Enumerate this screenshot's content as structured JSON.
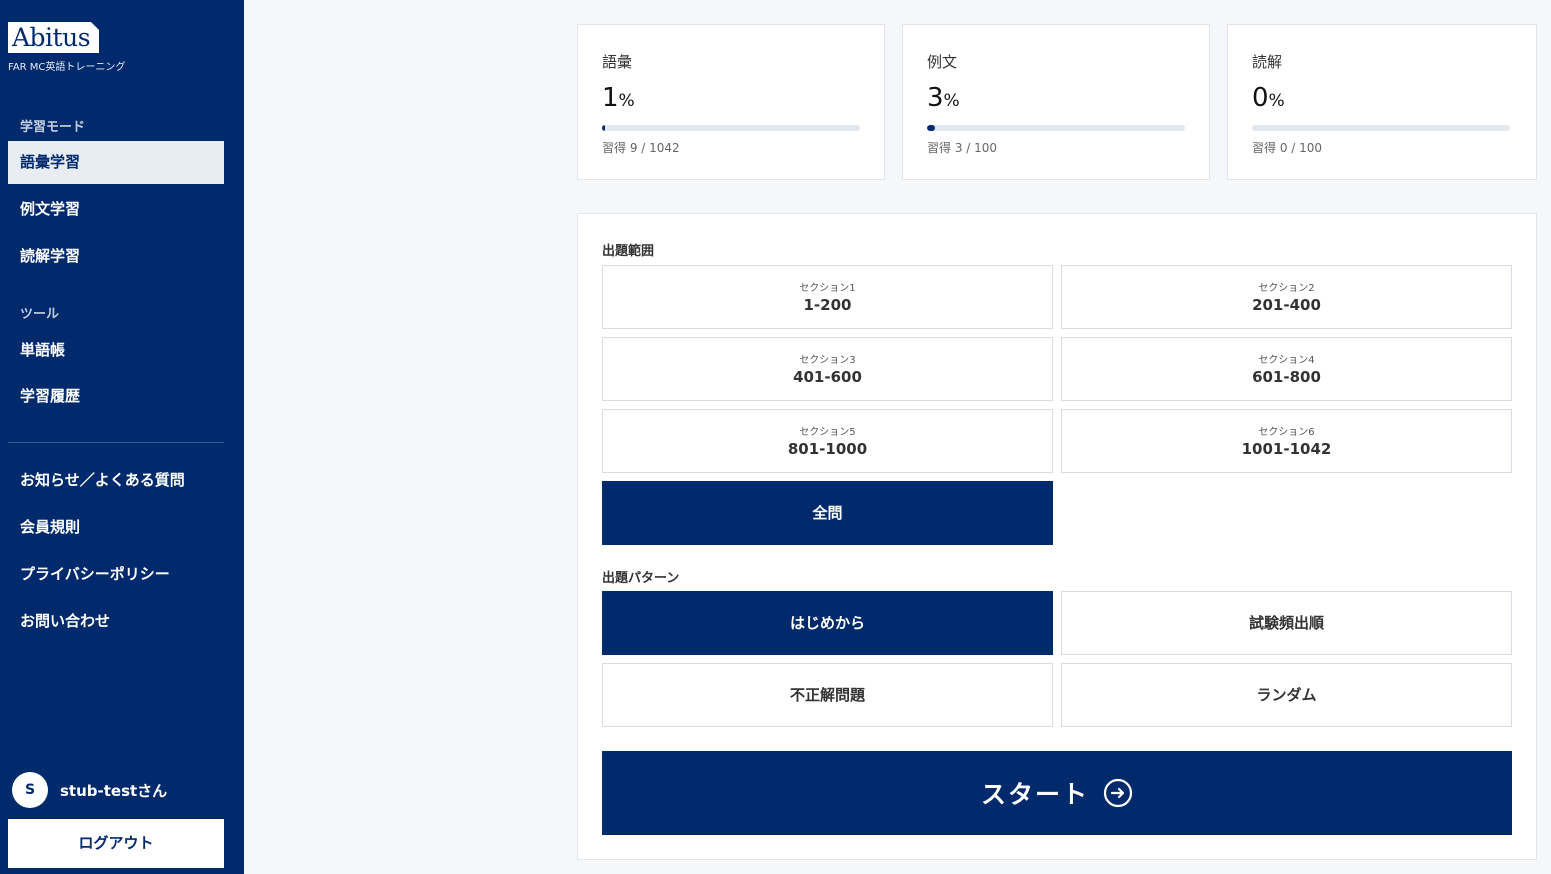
{
  "brand": {
    "logo": "Abitus",
    "subtitle": "FAR MC英語トレーニング"
  },
  "sidebar": {
    "learning_mode_label": "学習モード",
    "learning_items": [
      {
        "label": "語彙学習",
        "active": true
      },
      {
        "label": "例文学習",
        "active": false
      },
      {
        "label": "読解学習",
        "active": false
      }
    ],
    "tools_label": "ツール",
    "tool_items": [
      {
        "label": "単語帳"
      },
      {
        "label": "学習履歴"
      }
    ],
    "info_items": [
      {
        "label": "お知らせ／よくある質問"
      },
      {
        "label": "会員規則"
      },
      {
        "label": "プライバシーポリシー"
      },
      {
        "label": "お問い合わせ"
      }
    ],
    "user": {
      "avatar_initial": "S",
      "name": "stub-testさん"
    },
    "logout_label": "ログアウト"
  },
  "stats": [
    {
      "title": "語彙",
      "value": "1",
      "unit": "%",
      "progress": 0.01,
      "sub": "習得 9 / 1042"
    },
    {
      "title": "例文",
      "value": "3",
      "unit": "%",
      "progress": 0.03,
      "sub": "習得 3 / 100"
    },
    {
      "title": "読解",
      "value": "0",
      "unit": "%",
      "progress": 0.0,
      "sub": "習得 0 / 100"
    }
  ],
  "range": {
    "label": "出題範囲",
    "sections": [
      {
        "name": "セクション1",
        "range": "1-200"
      },
      {
        "name": "セクション2",
        "range": "201-400"
      },
      {
        "name": "セクション3",
        "range": "401-600"
      },
      {
        "name": "セクション4",
        "range": "601-800"
      },
      {
        "name": "セクション5",
        "range": "801-1000"
      },
      {
        "name": "セクション6",
        "range": "1001-1042"
      }
    ],
    "all_label": "全問",
    "all_selected": true
  },
  "pattern": {
    "label": "出題パターン",
    "options": [
      {
        "label": "はじめから",
        "selected": true
      },
      {
        "label": "試験頻出順",
        "selected": false
      },
      {
        "label": "不正解問題",
        "selected": false
      },
      {
        "label": "ランダム",
        "selected": false
      }
    ]
  },
  "start_label": "スタート",
  "colors": {
    "primary": "#012a6d",
    "background": "#f6f7fa",
    "progress_track": "#e3e7ef"
  }
}
